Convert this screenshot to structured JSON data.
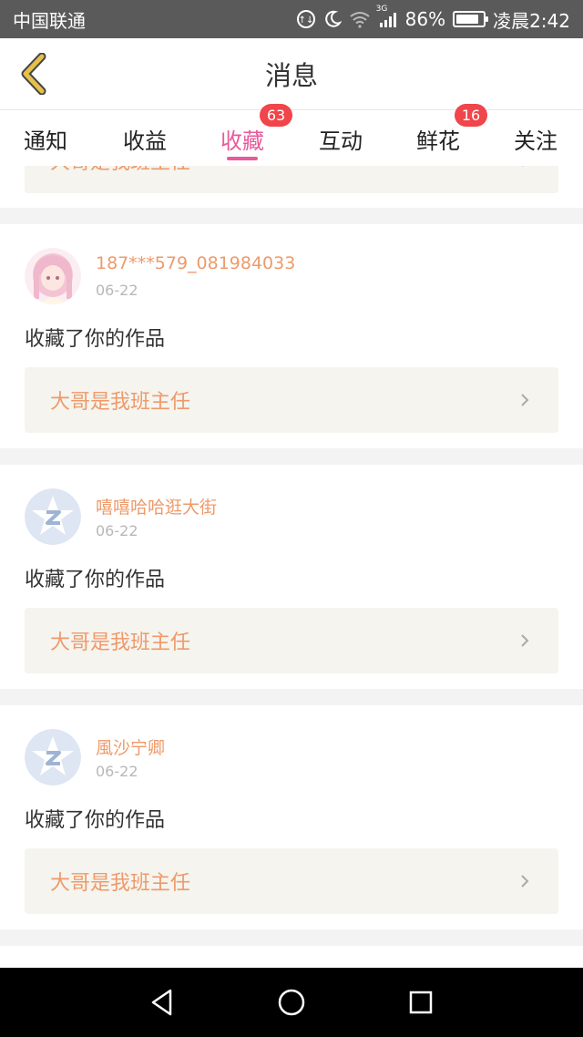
{
  "status_bar": {
    "carrier": "中国联通",
    "network": "3G",
    "battery": "86%",
    "battery_level": 0.86,
    "time": "凌晨2:42"
  },
  "header": {
    "title": "消息",
    "back_icon": "chevron-left-icon",
    "accent_color": "#e6c04a"
  },
  "tabs": [
    {
      "label": "通知",
      "badge": "",
      "active": false
    },
    {
      "label": "收益",
      "badge": "",
      "active": false
    },
    {
      "label": "收藏",
      "badge": "63",
      "active": true
    },
    {
      "label": "互动",
      "badge": "",
      "active": false
    },
    {
      "label": "鲜花",
      "badge": "16",
      "active": false
    },
    {
      "label": "关注",
      "badge": "",
      "active": false
    }
  ],
  "colors": {
    "active_tab": "#e85a9b",
    "badge": "#f0454a",
    "link": "#ee9a6b"
  },
  "partial_item": {
    "work_title": "大哥是我班主任"
  },
  "items": [
    {
      "avatar": "anime-girl-avatar",
      "username": "187***579_081984033",
      "date": "06-22",
      "action": "收藏了你的作品",
      "work_title": "大哥是我班主任"
    },
    {
      "avatar": "default-z-avatar",
      "username": "嘻嘻哈哈逛大街",
      "date": "06-22",
      "action": "收藏了你的作品",
      "work_title": "大哥是我班主任"
    },
    {
      "avatar": "default-z-avatar",
      "username": "風沙宁卿",
      "date": "06-22",
      "action": "收藏了你的作品",
      "work_title": "大哥是我班主任"
    }
  ],
  "nav_bar": [
    "back-triangle-icon",
    "home-circle-icon",
    "recents-square-icon"
  ]
}
